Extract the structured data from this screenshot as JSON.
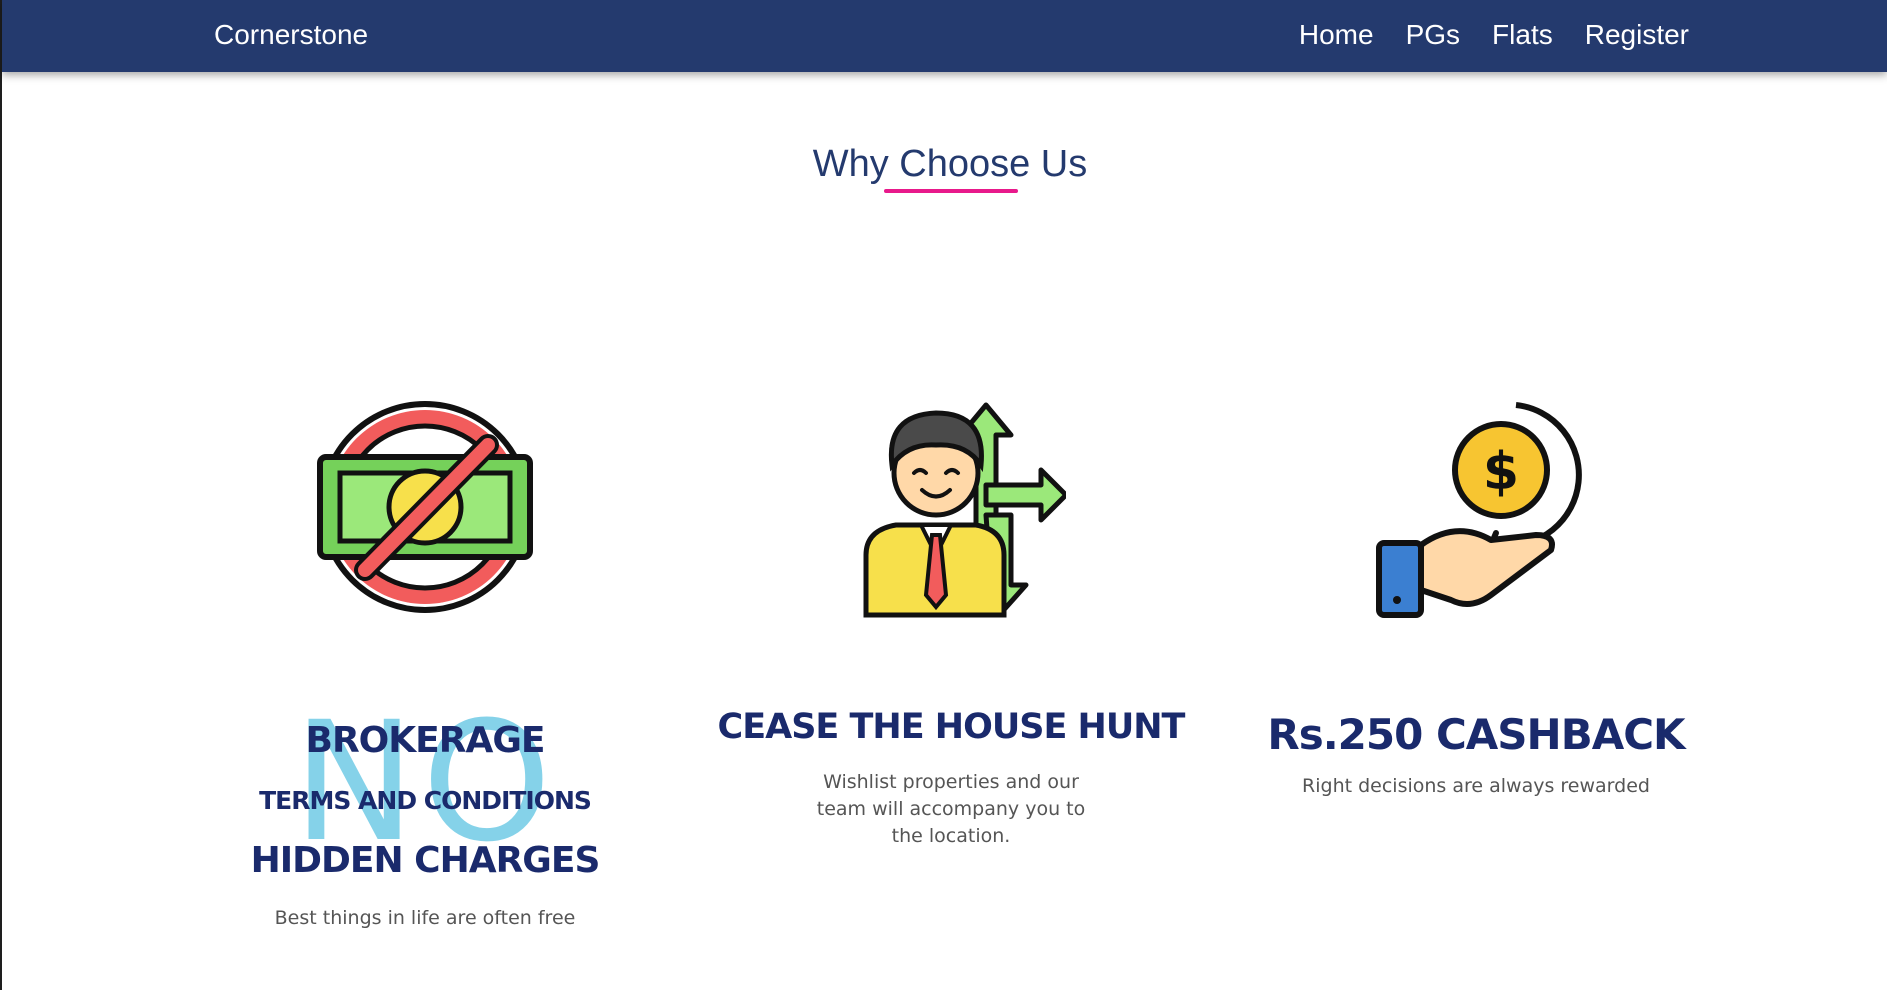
{
  "navbar": {
    "brand": "Cornerstone",
    "links": [
      "Home",
      "PGs",
      "Flats",
      "Register"
    ],
    "background": "#243a6e"
  },
  "section": {
    "title": "Why Choose Us",
    "underline_color": "#e8198b"
  },
  "cards": [
    {
      "icon": "no-money-icon",
      "watermark": "NO",
      "title_lines": [
        "BROKERAGE",
        "TERMS AND CONDITIONS",
        "HIDDEN CHARGES"
      ],
      "text": "Best things in life are often free"
    },
    {
      "icon": "house-hunt-person-icon",
      "title": "CEASE THE HOUSE HUNT",
      "text": "Wishlist properties and our team will accompany you to the location."
    },
    {
      "icon": "cashback-hand-icon",
      "title": "Rs.250 CASHBACK",
      "text": "Right decisions are always rewarded"
    }
  ]
}
